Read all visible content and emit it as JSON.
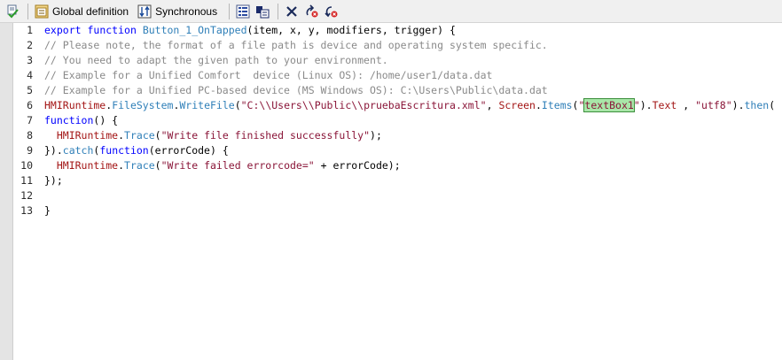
{
  "toolbar": {
    "global_definition_label": "Global definition",
    "synchronous_label": "Synchronous"
  },
  "colors": {
    "keyword": "#0000ff",
    "function": "#2f7fb8",
    "object": "#a31515",
    "string": "#8a1538",
    "comment": "#8a8a8a",
    "highlight": "#a8e6a8"
  },
  "editor": {
    "lines": [
      {
        "num": "1",
        "tokens": [
          {
            "t": "export",
            "c": "kw"
          },
          {
            "t": " ",
            "c": "plain"
          },
          {
            "t": "function",
            "c": "kw"
          },
          {
            "t": " ",
            "c": "plain"
          },
          {
            "t": "Button_1_OnTapped",
            "c": "fn"
          },
          {
            "t": "(item, x, y, modifiers, trigger) {",
            "c": "plain"
          }
        ]
      },
      {
        "num": "2",
        "tokens": [
          {
            "t": "// Please note, the format of a file path is device and operating system specific.",
            "c": "cmt"
          }
        ]
      },
      {
        "num": "3",
        "tokens": [
          {
            "t": "// You need to adapt the given path to your environment.",
            "c": "cmt"
          }
        ]
      },
      {
        "num": "4",
        "tokens": [
          {
            "t": "// Example for a Unified Comfort  device (Linux OS): /home/user1/data.dat",
            "c": "cmt"
          }
        ]
      },
      {
        "num": "5",
        "tokens": [
          {
            "t": "// Example for a Unified PC-based device (MS Windows OS): C:\\Users\\Public\\data.dat",
            "c": "cmt"
          }
        ]
      },
      {
        "num": "6",
        "tokens": [
          {
            "t": "HMIRuntime",
            "c": "obj"
          },
          {
            "t": ".",
            "c": "plain"
          },
          {
            "t": "FileSystem",
            "c": "mem"
          },
          {
            "t": ".",
            "c": "plain"
          },
          {
            "t": "WriteFile",
            "c": "mem"
          },
          {
            "t": "(",
            "c": "plain"
          },
          {
            "t": "\"C:\\\\Users\\\\Public\\\\pruebaEscritura.xml\"",
            "c": "str"
          },
          {
            "t": ", ",
            "c": "plain"
          },
          {
            "t": "Screen",
            "c": "obj"
          },
          {
            "t": ".",
            "c": "plain"
          },
          {
            "t": "Items",
            "c": "mem"
          },
          {
            "t": "(",
            "c": "plain"
          },
          {
            "t": "\"",
            "c": "str"
          },
          {
            "t": "textBox1",
            "c": "hl"
          },
          {
            "t": "\"",
            "c": "str"
          },
          {
            "t": ").",
            "c": "plain"
          },
          {
            "t": "Text",
            "c": "obj"
          },
          {
            "t": " , ",
            "c": "plain"
          },
          {
            "t": "\"utf8\"",
            "c": "str"
          },
          {
            "t": ").",
            "c": "plain"
          },
          {
            "t": "then",
            "c": "mem"
          },
          {
            "t": "(",
            "c": "plain"
          }
        ]
      },
      {
        "num": "7",
        "tokens": [
          {
            "t": "function",
            "c": "kw"
          },
          {
            "t": "() {",
            "c": "plain"
          }
        ]
      },
      {
        "num": "8",
        "tokens": [
          {
            "t": "  ",
            "c": "plain"
          },
          {
            "t": "HMIRuntime",
            "c": "obj"
          },
          {
            "t": ".",
            "c": "plain"
          },
          {
            "t": "Trace",
            "c": "mem"
          },
          {
            "t": "(",
            "c": "plain"
          },
          {
            "t": "\"Write file finished successfully\"",
            "c": "str"
          },
          {
            "t": ");",
            "c": "plain"
          }
        ]
      },
      {
        "num": "9",
        "tokens": [
          {
            "t": "}).",
            "c": "plain"
          },
          {
            "t": "catch",
            "c": "mem"
          },
          {
            "t": "(",
            "c": "plain"
          },
          {
            "t": "function",
            "c": "kw"
          },
          {
            "t": "(errorCode) {",
            "c": "plain"
          }
        ]
      },
      {
        "num": "10",
        "tokens": [
          {
            "t": "  ",
            "c": "plain"
          },
          {
            "t": "HMIRuntime",
            "c": "obj"
          },
          {
            "t": ".",
            "c": "plain"
          },
          {
            "t": "Trace",
            "c": "mem"
          },
          {
            "t": "(",
            "c": "plain"
          },
          {
            "t": "\"Write failed errorcode=\"",
            "c": "str"
          },
          {
            "t": " + errorCode);",
            "c": "plain"
          }
        ]
      },
      {
        "num": "11",
        "tokens": [
          {
            "t": "});",
            "c": "plain"
          }
        ]
      },
      {
        "num": "12",
        "tokens": []
      },
      {
        "num": "13",
        "tokens": [
          {
            "t": "}",
            "c": "plain"
          }
        ]
      }
    ]
  }
}
